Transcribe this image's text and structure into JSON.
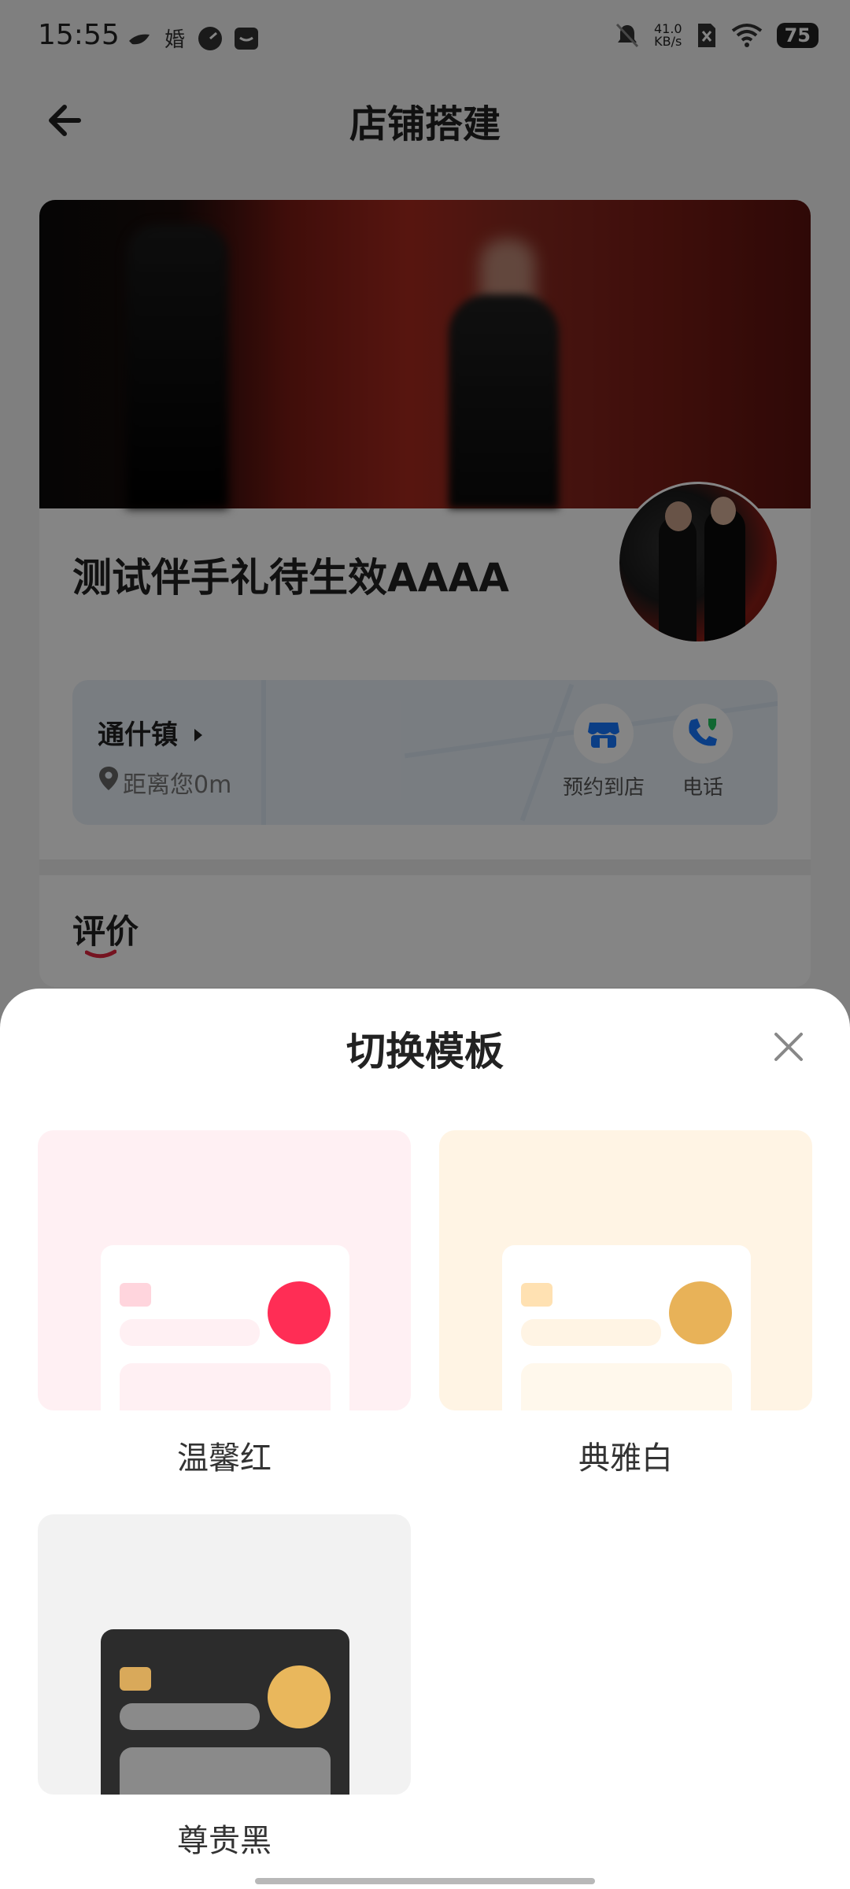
{
  "status_bar": {
    "time": "15:55",
    "left_icons": [
      "bird-icon",
      "wedding-icon",
      "speed-icon",
      "message-icon"
    ],
    "net_speed_value": "41.0",
    "net_speed_unit": "KB/s",
    "battery": "75",
    "right_icons": [
      "mute-icon",
      "sim-off-icon",
      "wifi-icon",
      "battery-icon"
    ]
  },
  "header": {
    "title": "店铺搭建",
    "back_icon": "arrow-left-icon"
  },
  "store": {
    "name": "测试伴手礼待生效AAAA",
    "town": "通什镇",
    "distance": "距离您0m",
    "actions": [
      {
        "label": "预约到店",
        "icon": "store-icon"
      },
      {
        "label": "电话",
        "icon": "phone-icon"
      }
    ],
    "review_title": "评价"
  },
  "sheet": {
    "title": "切换模板",
    "close_icon": "close-icon",
    "templates": [
      {
        "label": "温馨红",
        "bg": "#fff0f3",
        "accent": "#ff2d55",
        "card": "#ffffff",
        "tag": "#ffd5dd",
        "bar": "#fff0f3",
        "block": "#fff0f3"
      },
      {
        "label": "典雅白",
        "bg": "#fff4e4",
        "accent": "#e8b258",
        "card": "#ffffff",
        "tag": "#ffe1b2",
        "bar": "#fff4e4",
        "block": "#fff8ec"
      },
      {
        "label": "尊贵黑",
        "bg": "#f2f2f2",
        "accent": "#e9b75c",
        "card": "#2c2c2c",
        "tag": "#d9a95a",
        "bar": "#8a8a8a",
        "block": "#8a8a8a"
      }
    ]
  }
}
